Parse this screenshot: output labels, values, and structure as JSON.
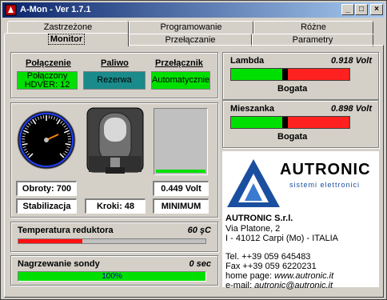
{
  "window": {
    "title": "A-Mon - Ver 1.7.1",
    "controls": [
      "_",
      "□",
      "×"
    ]
  },
  "tabs_row1": [
    {
      "label": "Zastrzeżone"
    },
    {
      "label": "Programowanie"
    },
    {
      "label": "Różne"
    }
  ],
  "tabs_row2": [
    {
      "label": "Monitor",
      "active": true
    },
    {
      "label": "Przełączanie"
    },
    {
      "label": "Parametry"
    }
  ],
  "status": {
    "polaczenie_label": "Połączenie",
    "polaczenie_value1": "Połączony",
    "polaczenie_value2": "HDVER: 12",
    "paliwo_label": "Paliwo",
    "paliwo_value": "Rezerwa",
    "przelacznik_label": "Przełącznik",
    "przelacznik_value": "Automatycznie"
  },
  "gauges": {
    "rpm_label": "Obroty: 700",
    "rpm_mode": "Stabilizacja",
    "kroki_label": "Kroki: 48",
    "volt_label": "0.449 Volt",
    "volt_mode": "MINIMUM",
    "volt_level": 0.05
  },
  "temperatura": {
    "label": "Temperatura reduktora",
    "value": "60 şC",
    "fill": 0.34
  },
  "nagrzewanie": {
    "label": "Nagrzewanie sondy",
    "value": "0 sec",
    "progress_text": "100%",
    "fill": 1.0
  },
  "lambda": {
    "label": "Lambda",
    "value": "0.918 Volt",
    "state": "Bogata",
    "marker": 0.455
  },
  "mieszanka": {
    "label": "Mieszanka",
    "value": "0.898 Volt",
    "state": "Bogata",
    "marker": 0.455
  },
  "company": {
    "logo_text": "AUTRONIC",
    "logo_subtext": "sistemi elettronici",
    "name": "AUTRONIC S.r.l.",
    "address1": "Via Platone, 2",
    "address2": "I - 41012 Carpi (Mo) - ITALIA",
    "tel": "Tel. ++39 059 645483",
    "fax": "Fax ++39 059 6220231",
    "homepage_label": "home page: ",
    "homepage": "www.autronic.it",
    "email_label": "e-mail: ",
    "email": "autronic@autronic.it"
  },
  "colors": {
    "green": "#00e000",
    "red": "#ff2020",
    "teal": "#1a8a8a",
    "titlebar": "#0a246a"
  }
}
